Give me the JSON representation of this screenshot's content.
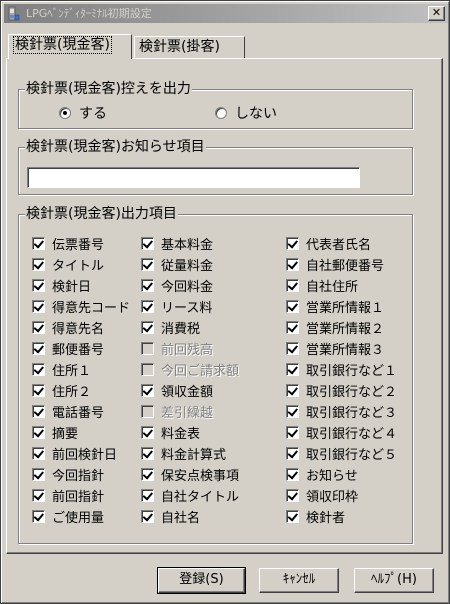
{
  "window": {
    "title": "LPGﾍﾞﾝﾃﾞｨﾀｰﾐﾅﾙ初期設定",
    "close_glyph": "✕"
  },
  "tabs": [
    {
      "label": "検針票(現金客)",
      "active": true
    },
    {
      "label": "検針票(掛客)",
      "active": false
    }
  ],
  "copy_output": {
    "title": "検針票(現金客)控えを出力",
    "options": [
      {
        "label": "する",
        "selected": true
      },
      {
        "label": "しない",
        "selected": false
      }
    ]
  },
  "notice": {
    "title": "検針票(現金客)お知らせ項目",
    "value": ""
  },
  "output_items": {
    "title": "検針票(現金客)出力項目",
    "columns": [
      [
        {
          "label": "伝票番号",
          "checked": true,
          "enabled": true
        },
        {
          "label": "タイトル",
          "checked": true,
          "enabled": true
        },
        {
          "label": "検針日",
          "checked": true,
          "enabled": true
        },
        {
          "label": "得意先コード",
          "checked": true,
          "enabled": true
        },
        {
          "label": "得意先名",
          "checked": true,
          "enabled": true
        },
        {
          "label": "郵便番号",
          "checked": true,
          "enabled": true
        },
        {
          "label": "住所１",
          "checked": true,
          "enabled": true
        },
        {
          "label": "住所２",
          "checked": true,
          "enabled": true
        },
        {
          "label": "電話番号",
          "checked": true,
          "enabled": true
        },
        {
          "label": "摘要",
          "checked": true,
          "enabled": true
        },
        {
          "label": "前回検針日",
          "checked": true,
          "enabled": true
        },
        {
          "label": "今回指針",
          "checked": true,
          "enabled": true
        },
        {
          "label": "前回指針",
          "checked": true,
          "enabled": true
        },
        {
          "label": "ご使用量",
          "checked": true,
          "enabled": true
        }
      ],
      [
        {
          "label": "基本料金",
          "checked": true,
          "enabled": true
        },
        {
          "label": "従量料金",
          "checked": true,
          "enabled": true
        },
        {
          "label": "今回料金",
          "checked": true,
          "enabled": true
        },
        {
          "label": "リース料",
          "checked": true,
          "enabled": true
        },
        {
          "label": "消費税",
          "checked": true,
          "enabled": true
        },
        {
          "label": "前回残高",
          "checked": false,
          "enabled": false
        },
        {
          "label": "今回ご請求額",
          "checked": false,
          "enabled": false
        },
        {
          "label": "領収金額",
          "checked": true,
          "enabled": true
        },
        {
          "label": "差引繰越",
          "checked": false,
          "enabled": false
        },
        {
          "label": "料金表",
          "checked": true,
          "enabled": true
        },
        {
          "label": "料金計算式",
          "checked": true,
          "enabled": true
        },
        {
          "label": "保安点検事項",
          "checked": true,
          "enabled": true
        },
        {
          "label": "自社タイトル",
          "checked": true,
          "enabled": true
        },
        {
          "label": "自社名",
          "checked": true,
          "enabled": true
        }
      ],
      [
        {
          "label": "代表者氏名",
          "checked": true,
          "enabled": true
        },
        {
          "label": "自社郵便番号",
          "checked": true,
          "enabled": true
        },
        {
          "label": "自社住所",
          "checked": true,
          "enabled": true
        },
        {
          "label": "営業所情報１",
          "checked": true,
          "enabled": true
        },
        {
          "label": "営業所情報２",
          "checked": true,
          "enabled": true
        },
        {
          "label": "営業所情報３",
          "checked": true,
          "enabled": true
        },
        {
          "label": "取引銀行など１",
          "checked": true,
          "enabled": true
        },
        {
          "label": "取引銀行など２",
          "checked": true,
          "enabled": true
        },
        {
          "label": "取引銀行など３",
          "checked": true,
          "enabled": true
        },
        {
          "label": "取引銀行など４",
          "checked": true,
          "enabled": true
        },
        {
          "label": "取引銀行など５",
          "checked": true,
          "enabled": true
        },
        {
          "label": "お知らせ",
          "checked": true,
          "enabled": true
        },
        {
          "label": "領収印枠",
          "checked": true,
          "enabled": true
        },
        {
          "label": "検針者",
          "checked": true,
          "enabled": true
        }
      ]
    ]
  },
  "buttons": {
    "register": "登録(S)",
    "cancel": "ｷｬﾝｾﾙ",
    "help": "ﾍﾙﾌﾟ(H)"
  },
  "icons": {
    "app": "app-icon",
    "close": "close-icon"
  }
}
